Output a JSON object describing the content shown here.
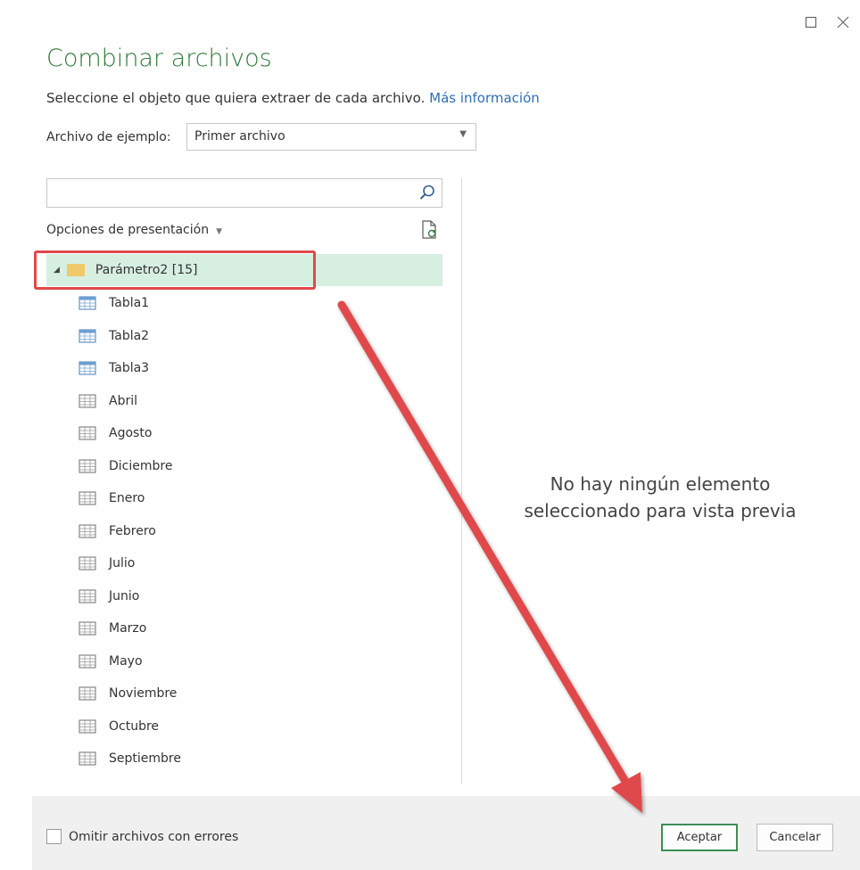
{
  "dialog": {
    "title": "Combinar archivos",
    "subtitle": "Seleccione el objeto que quiera extraer de cada archivo.",
    "more_info_link": "Más información"
  },
  "example_file": {
    "label": "Archivo de ejemplo:",
    "selected": "Primer archivo"
  },
  "search": {
    "value": "",
    "placeholder": ""
  },
  "display_options_label": "Opciones de presentación",
  "tree": {
    "root": {
      "label": "Parámetro2 [15]",
      "expanded": true
    },
    "items": [
      {
        "label": "Tabla1",
        "icon": "table-icon"
      },
      {
        "label": "Tabla2",
        "icon": "table-icon"
      },
      {
        "label": "Tabla3",
        "icon": "table-icon"
      },
      {
        "label": "Abril",
        "icon": "sheet-icon"
      },
      {
        "label": "Agosto",
        "icon": "sheet-icon"
      },
      {
        "label": "Diciembre",
        "icon": "sheet-icon"
      },
      {
        "label": "Enero",
        "icon": "sheet-icon"
      },
      {
        "label": "Febrero",
        "icon": "sheet-icon"
      },
      {
        "label": "Julio",
        "icon": "sheet-icon"
      },
      {
        "label": "Junio",
        "icon": "sheet-icon"
      },
      {
        "label": "Marzo",
        "icon": "sheet-icon"
      },
      {
        "label": "Mayo",
        "icon": "sheet-icon"
      },
      {
        "label": "Noviembre",
        "icon": "sheet-icon"
      },
      {
        "label": "Octubre",
        "icon": "sheet-icon"
      },
      {
        "label": "Septiembre",
        "icon": "sheet-icon"
      }
    ]
  },
  "preview": {
    "line1": "No hay ningún elemento",
    "line2": "seleccionado para vista previa"
  },
  "footer": {
    "skip_errors_label": "Omitir archivos con errores",
    "skip_errors_checked": false,
    "ok_label": "Aceptar",
    "cancel_label": "Cancelar"
  },
  "colors": {
    "title": "#2f7a3a",
    "link": "#2f6eb5",
    "selection": "#d6efe1",
    "annotation": "#e0484b",
    "ok_border": "#3b8e55"
  }
}
